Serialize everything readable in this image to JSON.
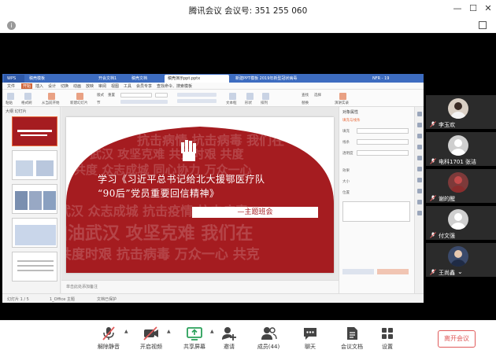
{
  "window": {
    "title": "腾讯会议 会议号: 351 255 060",
    "minimize": "—",
    "maximize": "☐",
    "close": "✕",
    "info": "i"
  },
  "shared_screen": {
    "tabs": [
      "WPS",
      "稿壳模板",
      "开会文档1",
      "稿壳文档",
      "稿壳演示ppt.pptx",
      "新建PPT模板 2019年新型冠状病毒",
      "NFR - 19"
    ],
    "menu": [
      "文件",
      "开始",
      "插入",
      "设计",
      "切换",
      "动画",
      "放映",
      "审阅",
      "视图",
      "工具",
      "会员专享",
      "查找命令、搜索模板"
    ],
    "toolbar_labels": [
      "粘贴",
      "格式刷",
      "从当前开始",
      "新建幻灯片",
      "版式",
      "节",
      "重置",
      "文本框",
      "形状",
      "排列",
      "查找",
      "替换",
      "选择",
      "演讲实录"
    ],
    "left_header": "大纲 幻灯片",
    "slide_numbers": [
      "1",
      "2",
      "3",
      "4",
      "5"
    ],
    "slide": {
      "bg_words_rows": [
        "抗击病情 抗击病毒 我们在",
        "武汉 攻坚克难 共克时艰 共度",
        "共度 众志成城 同心协力 万众一心",
        "武汉 众志成城 抗击疫情 抗击病毒",
        "加油武汉 攻坚克难 我们在",
        "共度时艰 抗击病毒 万众一心 共克"
      ],
      "title_line1": "学习《习近平总书记给北大援鄂医疗队",
      "title_line2": "“90后”党员重要回信精神》",
      "subtitle": "—主题班会"
    },
    "notes": "单击此处添加备注",
    "right_panel_title": "对象属性",
    "right_rows": [
      "填充与线条",
      "填充",
      "线条",
      "透明度",
      "效果",
      "大小",
      "位置"
    ],
    "status": [
      "幻灯片 1 / 5",
      "1_Office 主题",
      "文档已保护"
    ]
  },
  "participants": [
    {
      "name": "李玉欢"
    },
    {
      "name": "电科1701 张洁"
    },
    {
      "name": "谢的醒"
    },
    {
      "name": "付文强"
    },
    {
      "name": "王尚鑫"
    }
  ],
  "toolbar": {
    "unmute": "解除静音",
    "video": "开启视频",
    "share": "共享屏幕",
    "invite": "邀请",
    "members": "成员(44)",
    "chat": "聊天",
    "docs": "会议文档",
    "settings": "设置",
    "leave": "离开会议"
  },
  "colors": {
    "slide_red": "#a51c20",
    "accent_red": "#e05a5a",
    "share_green": "#2aa05a",
    "wps_blue": "#3d6cc0"
  }
}
